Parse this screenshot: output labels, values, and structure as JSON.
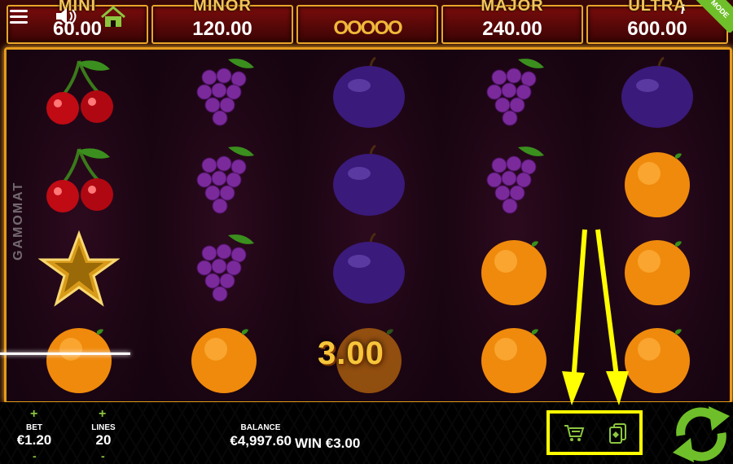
{
  "jackpots": [
    {
      "label": "MINI",
      "value": "60.00"
    },
    {
      "label": "MINOR",
      "value": "120.00"
    },
    {
      "label": "",
      "value": "OOOOO"
    },
    {
      "label": "MAJOR",
      "value": "240.00"
    },
    {
      "label": "ULTRA",
      "value": "600.00"
    }
  ],
  "mode_badge": "MODE",
  "brand": "GAMOMAT",
  "reels": [
    [
      "cherry",
      "cherry",
      "star",
      "orange"
    ],
    [
      "grapes",
      "grapes",
      "grapes",
      "orange"
    ],
    [
      "plum",
      "plum",
      "plum",
      "orange"
    ],
    [
      "grapes",
      "grapes",
      "orange",
      "orange"
    ],
    [
      "plum",
      "orange",
      "orange",
      "orange"
    ]
  ],
  "win_overlay": "3.00",
  "bet": {
    "label": "BET",
    "value": "€1.20",
    "plus": "+",
    "minus": "-"
  },
  "lines": {
    "label": "LINES",
    "value": "20",
    "plus": "+",
    "minus": "-"
  },
  "balance": {
    "label": "BALANCE",
    "value": "€4,997.60"
  },
  "win": {
    "text": "WIN €3.00"
  },
  "icons": {
    "menu": "menu-icon",
    "sound": "speaker-icon",
    "home": "home-icon",
    "cart": "cart-icon",
    "cards": "cards-icon",
    "spin": "spin-icon"
  },
  "colors": {
    "gold": "#e59a1c",
    "green": "#8cc63f",
    "highlight": "#ffff00"
  }
}
